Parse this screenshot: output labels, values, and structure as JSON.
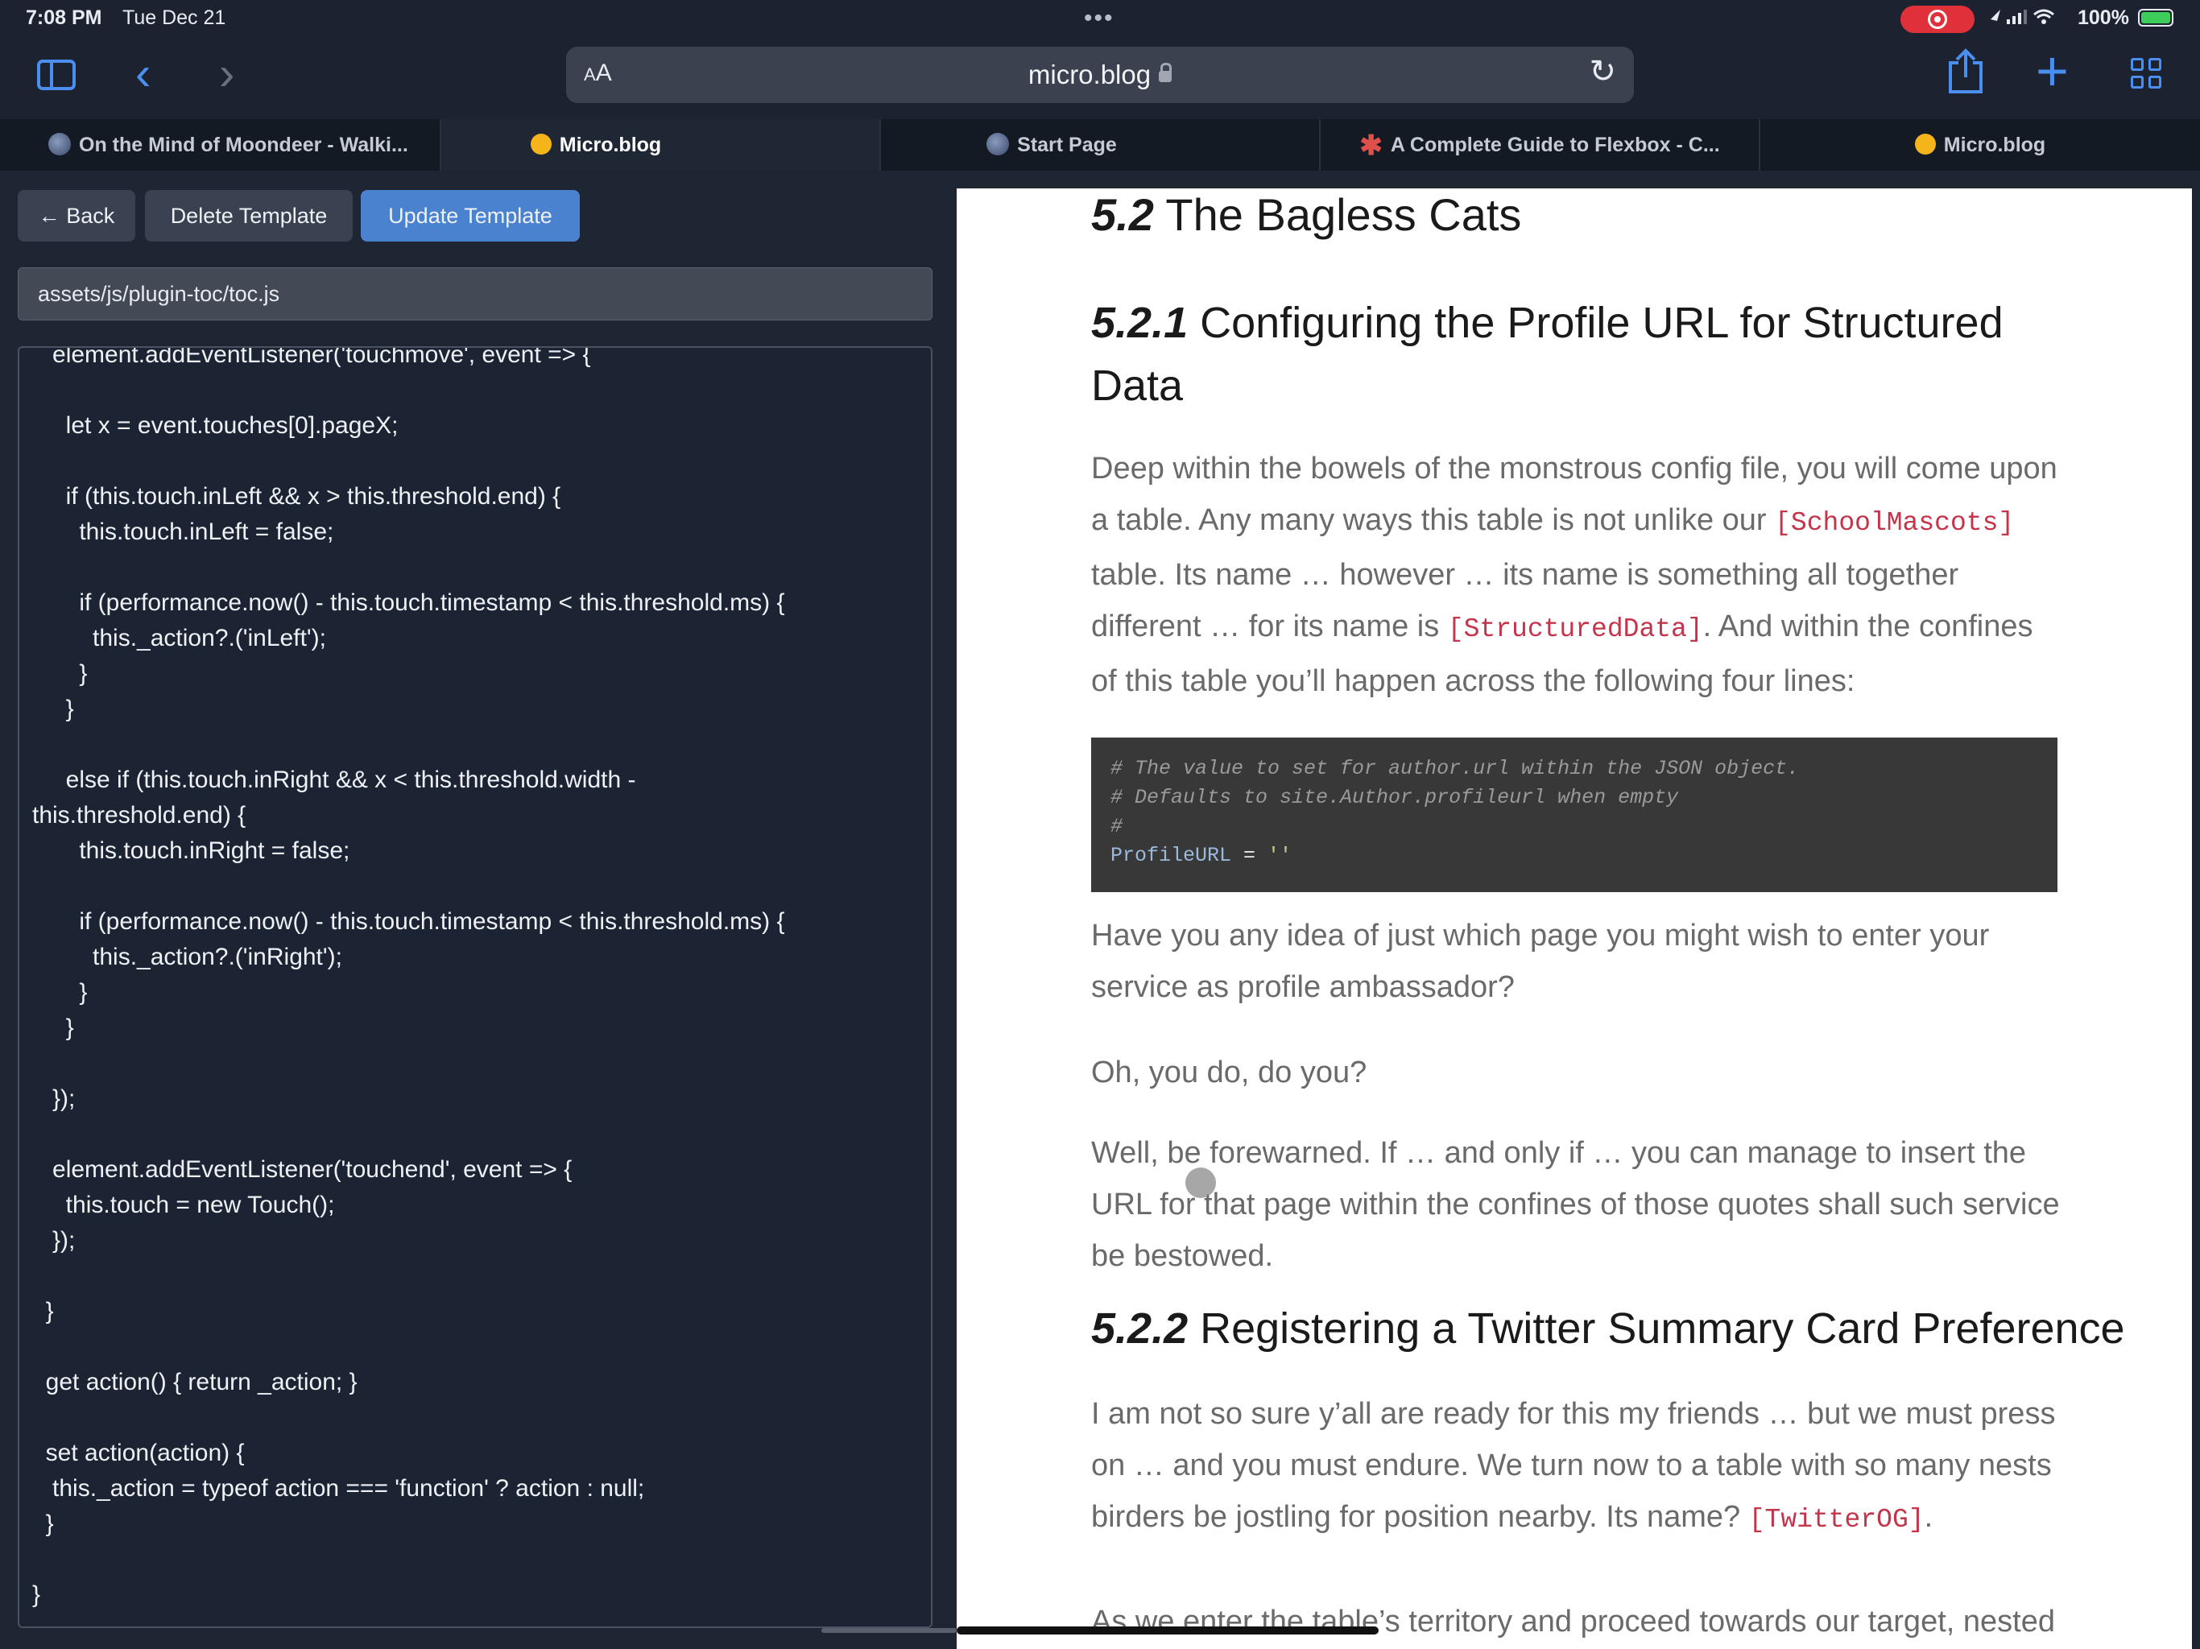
{
  "status_bar": {
    "time": "7:08 PM",
    "date": "Tue Dec 21",
    "multitask_dots": "•••",
    "battery": "100%"
  },
  "toolbar": {
    "reader_label_small": "A",
    "reader_label_large": "A",
    "url": "micro.blog"
  },
  "tabs": [
    {
      "title": "On the Mind of Moondeer - Walki...",
      "favicon": "moon-icon",
      "active": false
    },
    {
      "title": "Micro.blog",
      "favicon": "micro-blog-icon",
      "active": true
    },
    {
      "title": "Start Page",
      "favicon": "moon-icon",
      "active": false
    },
    {
      "title": "A Complete Guide to Flexbox - C...",
      "favicon": "star-icon",
      "active": false
    },
    {
      "title": "Micro.blog",
      "favicon": "micro-blog-icon",
      "active": false
    }
  ],
  "editor": {
    "back_label": "← Back",
    "delete_label": "Delete Template",
    "update_label": "Update Template",
    "path": "assets/js/plugin-toc/toc.js",
    "code_lines": [
      "   element.addEventListener('touchmove', event => {",
      "",
      "     let x = event.touches[0].pageX;",
      "",
      "     if (this.touch.inLeft && x > this.threshold.end) {",
      "       this.touch.inLeft = false;",
      "",
      "       if (performance.now() - this.touch.timestamp < this.threshold.ms) {",
      "         this._action?.('inLeft');",
      "       }",
      "     }",
      "",
      "     else if (this.touch.inRight && x < this.threshold.width -",
      "this.threshold.end) {",
      "       this.touch.inRight = false;",
      "",
      "       if (performance.now() - this.touch.timestamp < this.threshold.ms) {",
      "         this._action?.('inRight');",
      "       }",
      "     }",
      "",
      "   });",
      "",
      "   element.addEventListener('touchend', event => {",
      "     this.touch = new Touch();",
      "   });",
      "",
      "  }",
      "",
      "  get action() { return _action; }",
      "",
      "  set action(action) {",
      "   this._action = typeof action === 'function' ? action : null;",
      "  }",
      "",
      "}"
    ]
  },
  "article": {
    "h52_num": "5.2",
    "h52_text": "The Bagless Cats",
    "h521_num": "5.2.1",
    "h521_text": "Configuring the Profile URL for Structured Data",
    "p1": {
      "a": "Deep within the bowels of the monstrous config file, you will come upon a table. Any many ways this table is not unlike our ",
      "code1": "[SchoolMascots]",
      "b": " table. Its name … however … its name is something all together different … for its name is ",
      "code2": "[StructuredData]",
      "c": ". And within the confines of this table you’ll happen across the following four lines:"
    },
    "code_block": {
      "line1": "# The value to set for author.url within the JSON object.",
      "line2": "# Defaults to site.Author.profileurl when empty",
      "line3": "#",
      "key": "ProfileURL",
      "eq": " = ",
      "value": "''"
    },
    "p2": "Have you any idea of just which page you might wish to enter your service as profile ambassador?",
    "p3": "Oh, you do, do you?",
    "p4": "Well, be forewarned. If … and only if … you can manage to insert the URL for that page within the confines of those quotes shall such service be bestowed.",
    "h522_num": "5.2.2",
    "h522_text": "Registering a Twitter Summary Card Preference",
    "p5": {
      "a": "I am not so sure y’all are ready for this my friends … but we must press on … and you must endure. We turn now to a table with so many nests birders be jostling for position nearby. Its name? ",
      "code": "[TwitterOG]",
      "b": "."
    },
    "p6": "As we enter the table’s territory and proceed towards our target, nested"
  },
  "colors": {
    "accent": "#4a8ff0",
    "update_button": "#4a82d0",
    "inline_code": "#c4344a",
    "record": "#e0303a",
    "battery": "#3ccd5b"
  }
}
